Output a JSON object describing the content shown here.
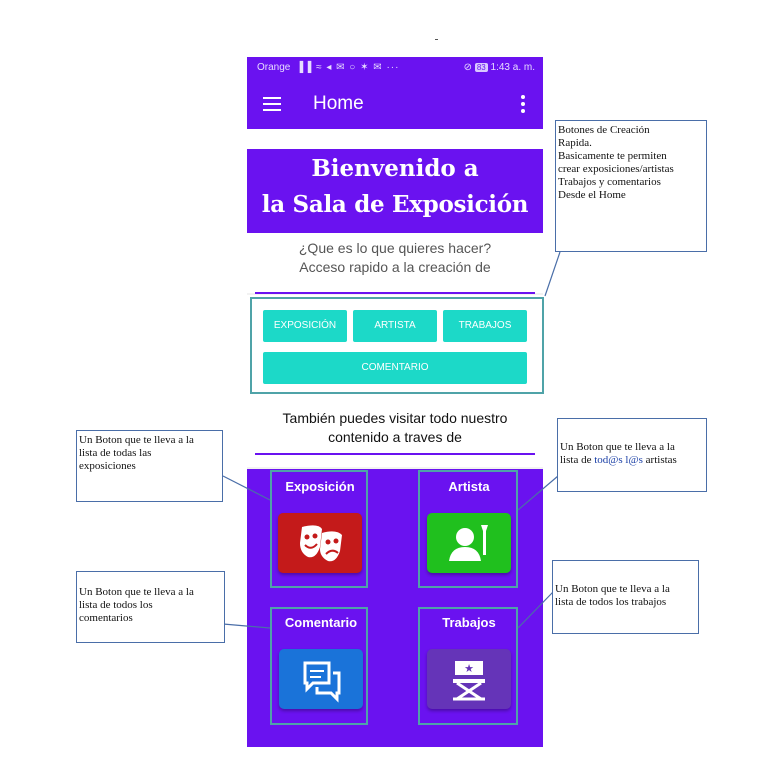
{
  "status_bar": {
    "carrier": "Orange",
    "signal_icons": "▐▐ ≈ ◂ ✉ ○ ✶ ✉ ···",
    "battery": "83",
    "time": "1:43 a. m."
  },
  "app_bar": {
    "title": "Home"
  },
  "banner": {
    "line1": "Bienvenido a",
    "line2": "la Sala de Exposición"
  },
  "question": {
    "line1": "¿Que es lo que quieres hacer?",
    "line2": "Acceso rapido a la creación de"
  },
  "quick_buttons": {
    "exposicion": "EXPOSICIÓN",
    "artista": "ARTISTA",
    "trabajos": "TRABAJOS",
    "comentario": "COMENTARIO"
  },
  "visit": {
    "line1": "También puedes visitar todo nuestro",
    "line2": "contenido a traves de"
  },
  "tiles": {
    "exposicion": "Exposición",
    "artista": "Artista",
    "comentario": "Comentario",
    "trabajos": "Trabajos"
  },
  "annotations": {
    "quick": {
      "l1": " Botones de Creación",
      "l2": "Rapida.",
      "l3": "Basicamente te permiten",
      "l4": "crear exposiciones/artistas",
      "l5": "Trabajos y comentarios",
      "l6": "Desde el Home"
    },
    "exposiciones": {
      "l1": "Un Boton que te lleva a la",
      "l2": "lista de todas las",
      "l3": "exposiciones"
    },
    "artistas": {
      "l1": "Un Boton que te lleva a la",
      "l2a": "lista de ",
      "l2b": "tod@s l@s",
      "l2c": " artistas"
    },
    "comentarios": {
      "l1": "Un Boton que te lleva a la",
      "l2": "lista de todos los",
      "l3": "comentarios"
    },
    "trabajos": {
      "l1": "Un Boton que te lleva a la",
      "l2": "lista de todos los trabajos"
    }
  },
  "colors": {
    "primary": "#6a12f0",
    "accent": "#1cd9c8",
    "exposicion_tile": "#c41a1a",
    "artista_tile": "#20c01e",
    "comentario_tile": "#1a73d9",
    "trabajos_tile": "#6534b8",
    "highlight": "#4fa3a8"
  }
}
